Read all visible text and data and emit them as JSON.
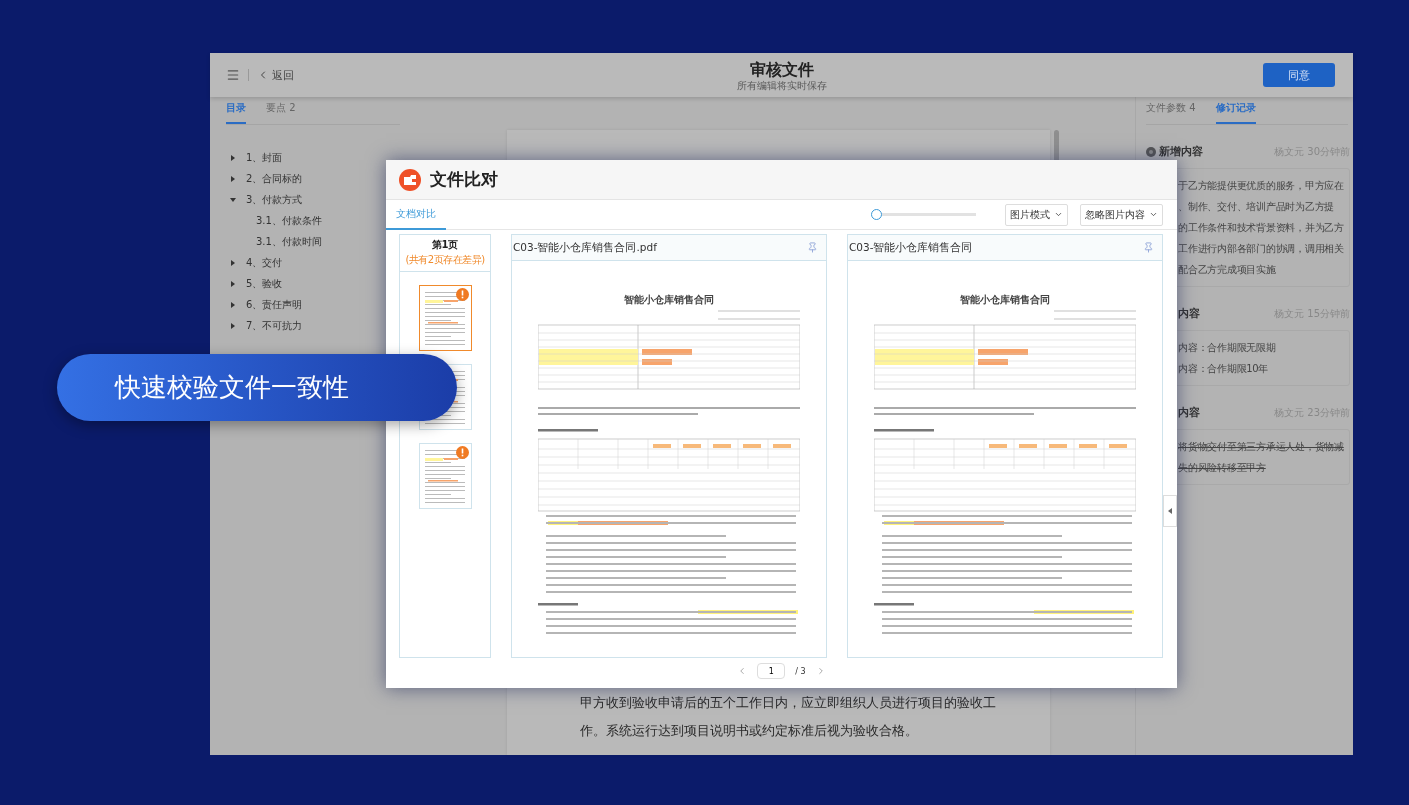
{
  "header": {
    "back_label": "返回",
    "title": "审核文件",
    "subtitle": "所有编辑将实时保存",
    "action_button": "同意"
  },
  "left_tabs": [
    {
      "label": "目录",
      "selected": true
    },
    {
      "label": "要点 2",
      "selected": false
    }
  ],
  "outline": [
    {
      "label": "1、封面",
      "expanded": false
    },
    {
      "label": "2、合同标的",
      "expanded": false
    },
    {
      "label": "3、付款方式",
      "expanded": true,
      "children": [
        {
          "label": "3.1、付款条件"
        },
        {
          "label": "3.1、付款时间"
        }
      ]
    },
    {
      "label": "4、交付",
      "expanded": false
    },
    {
      "label": "5、验收",
      "expanded": false
    },
    {
      "label": "6、责任声明",
      "expanded": false
    },
    {
      "label": "7、不可抗力",
      "expanded": false
    }
  ],
  "document_text": "甲方收到验收申请后的五个工作日内，应立即组织人员进行项目的验收工作。系统运行达到项目说明书或约定标准后视为验收合格。",
  "right_tabs": [
    {
      "label": "文件参数 4",
      "selected": false
    },
    {
      "label": "修订记录",
      "selected": true
    }
  ],
  "revisions": [
    {
      "title": "新增内容",
      "author": "杨文元",
      "time": "30分钟前",
      "struck": false,
      "lines": [
        "于乙方能提供更优质的服务，甲方应在",
        "、制作、交付、培训产品时为乙方提",
        "的工作条件和技术背景资料，并为乙方",
        "工作进行内部各部门的协调，调用相关",
        "配合乙方完成项目实施"
      ]
    },
    {
      "title": "内容",
      "author": "杨文元",
      "time": "15分钟前",
      "struck": false,
      "lines": [
        "内容：合作期限无限期",
        "内容：合作期限10年"
      ]
    },
    {
      "title": "内容",
      "author": "杨文元",
      "time": "23分钟前",
      "struck": true,
      "lines": [
        "将货物交付至第三方承运人处，货物减",
        "失的风险转移至甲方"
      ]
    }
  ],
  "modal": {
    "title": "文件比对",
    "tabs": [
      {
        "label": "文档对比",
        "selected": true
      }
    ],
    "zoom": {
      "level": 0
    },
    "dropdowns": [
      "图片模式",
      "忽略图片内容"
    ],
    "pages_header": {
      "title": "第1页",
      "note": "(共有2页存在差异)"
    },
    "thumbnails": [
      {
        "selected": true,
        "has_diff": true
      },
      {
        "selected": false,
        "has_diff": false
      },
      {
        "selected": false,
        "has_diff": true
      }
    ],
    "panes": [
      {
        "filename": "C03-智能小仓库销售合同.pdf",
        "doc_title": "智能小仓库销售合同"
      },
      {
        "filename": "C03-智能小仓库销售合同",
        "doc_title": "智能小仓库销售合同"
      }
    ],
    "pagination": {
      "current": "1",
      "total": "/ 3"
    }
  },
  "banner": "快速校验文件一致性"
}
